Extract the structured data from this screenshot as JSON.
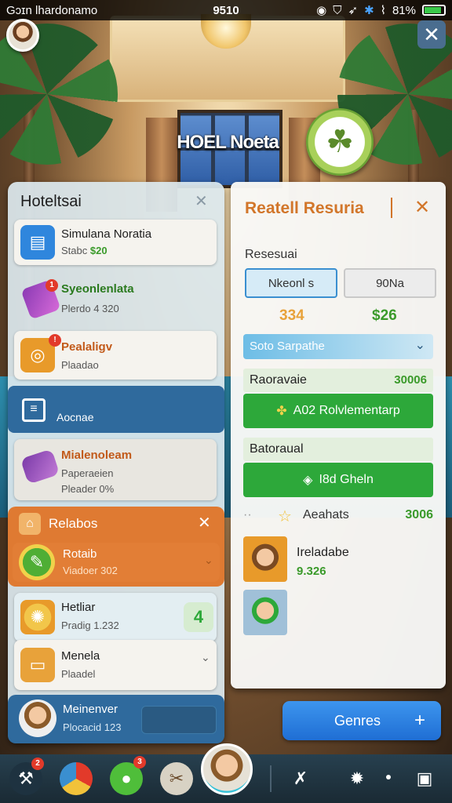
{
  "status_bar": {
    "carrier": "Gɔɪn lhardonamo",
    "time": "9510",
    "battery": "81%"
  },
  "hotel": {
    "name": "HOEL Noeta"
  },
  "left_panel": {
    "title": "Hoteltsai",
    "items": [
      {
        "title": "Simulana Noratia",
        "sub_prefix": "Stabc",
        "sub_value": "$20"
      },
      {
        "title": "Syeonlenlata",
        "sub": "Plerdo 4 320"
      },
      {
        "title": "Pealaligv",
        "sub": "Plaadao"
      },
      {
        "title": "Aocnae"
      },
      {
        "title": "Mialenoleam",
        "sub": "Paperaeien",
        "sub2": "Pleader 0%"
      },
      {
        "title": "Relabos"
      },
      {
        "title": "Rotaib",
        "sub": "Viadoer 302"
      },
      {
        "title": "Hetliar",
        "sub": "Pradig 1.232",
        "badge_value": "4"
      },
      {
        "title": "Menela",
        "sub": "Plaadel"
      },
      {
        "title": "Meinenver",
        "sub": "Plocacid 123"
      }
    ]
  },
  "right_panel": {
    "title": "Reatell Resuria",
    "subtitle": "Resesuai",
    "segments": [
      "Nkeonl s",
      "90Na"
    ],
    "prices": [
      "334",
      "$26"
    ],
    "dropdown_label": "Soto Sarpathe",
    "row1_label": "Raoravaie",
    "row1_value": "30006",
    "button1_label": "A02 Rolvlementarp",
    "row2_label": "Batoraual",
    "button2_label": "I8d Gheln",
    "achievements_label": "Aeahats",
    "achievements_value": "3006",
    "character_name": "Ireladabe",
    "character_value": "9.326"
  },
  "genres_button": {
    "label": "Genres",
    "icon": "+"
  },
  "colors": {
    "accent_orange": "#d2762a",
    "green": "#2da83a",
    "blue": "#2f6a9d"
  }
}
